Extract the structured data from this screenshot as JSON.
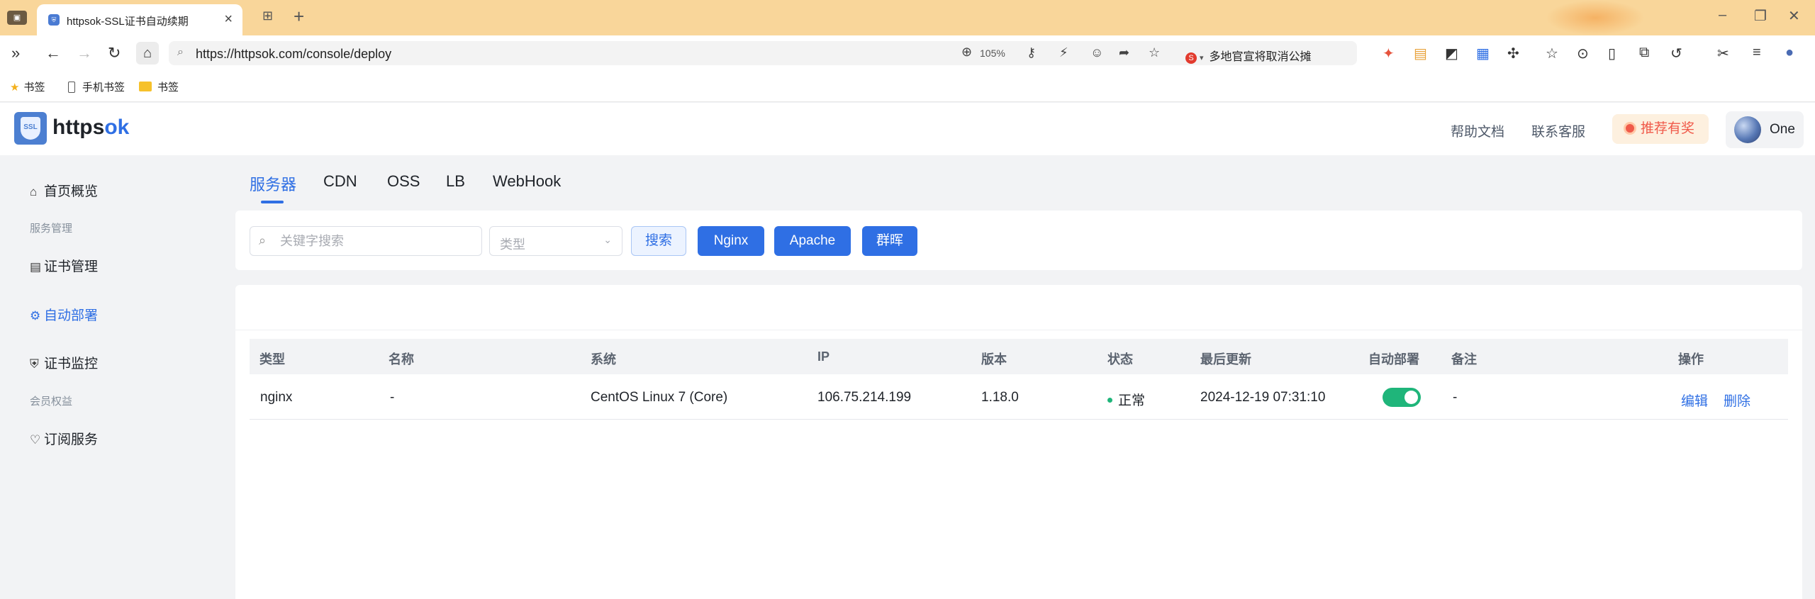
{
  "browser": {
    "tab_title": "httpsok-SSL证书自动续期",
    "tab_favicon": "ssl-shield-icon",
    "url": "https://httpsok.com/console/deploy",
    "zoom": "105%",
    "news_text": "多地官宣将取消公摊",
    "news_logo": "S",
    "bookmarks": [
      "书签",
      "手机书签",
      "书签"
    ]
  },
  "header": {
    "logo_badge": "SSL",
    "logo_text_main": "https",
    "logo_text_accent": "ok",
    "help_docs": "帮助文档",
    "contact_support": "联系客服",
    "referral": "推荐有奖",
    "user_name": "One"
  },
  "sidebar": {
    "home": "首页概览",
    "group_service": "服务管理",
    "cert_manage": "证书管理",
    "auto_deploy": "自动部署",
    "cert_monitor": "证书监控",
    "group_member": "会员权益",
    "subscription": "订阅服务"
  },
  "subtabs": [
    "服务器",
    "CDN",
    "OSS",
    "LB",
    "WebHook"
  ],
  "filter": {
    "search_placeholder": "关键字搜索",
    "type_placeholder": "类型",
    "search_button": "搜索",
    "nginx_button": "Nginx",
    "apache_button": "Apache",
    "qunhui_button": "群晖"
  },
  "table": {
    "headers": [
      "类型",
      "名称",
      "系统",
      "IP",
      "版本",
      "状态",
      "最后更新",
      "自动部署",
      "备注",
      "操作"
    ],
    "rows": [
      {
        "type": "nginx",
        "name": "-",
        "system": "CentOS Linux 7 (Core)",
        "ip": "106.75.214.199",
        "version": "1.18.0",
        "status": "正常",
        "updated": "2024-12-19 07:31:10",
        "auto_deploy": true,
        "remark": "-",
        "edit": "编辑",
        "delete": "删除"
      }
    ]
  },
  "colors": {
    "accent": "#2f6fe4",
    "success": "#1fb57a",
    "tabbar": "#f9d69a",
    "referral_text": "#f05a4a"
  }
}
